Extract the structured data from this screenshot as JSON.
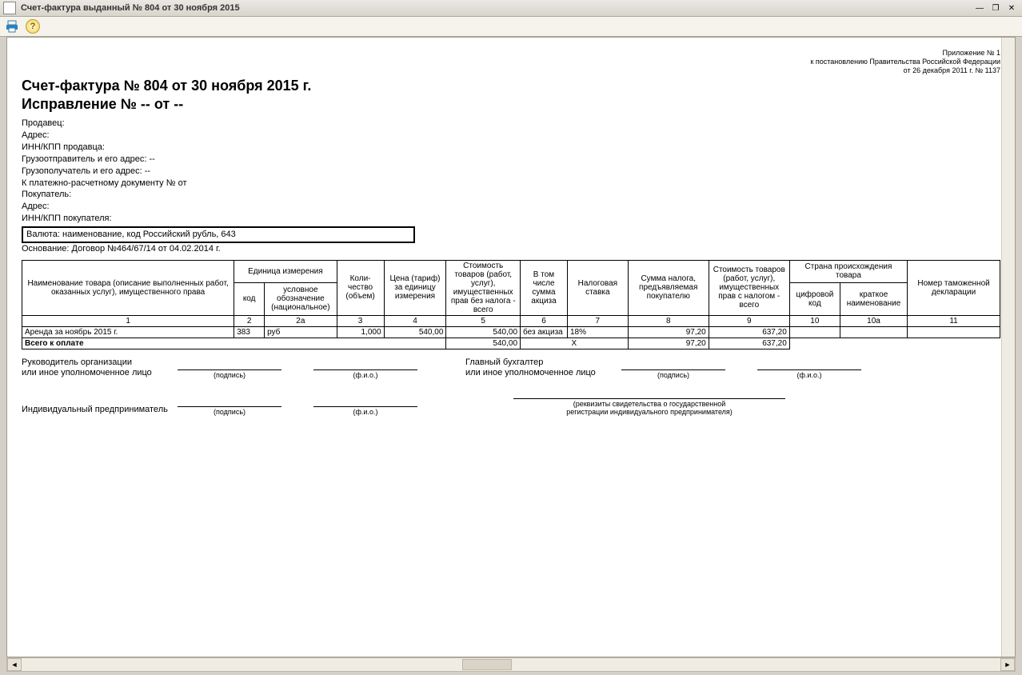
{
  "window": {
    "title": "Счет-фактура выданный № 804 от 30 ноября 2015"
  },
  "appendix": {
    "line1": "Приложение № 1",
    "line2": "к постановлению Правительства Российской Федерации",
    "line3": "от 26 декабря 2011 г. № 1137"
  },
  "doc": {
    "title": "Счет-фактура № 804 от 30 ноября 2015 г.",
    "correction": "Исправление № -- от --"
  },
  "header": {
    "seller": "Продавец:",
    "address": "Адрес:",
    "inn_seller": "ИНН/КПП продавца:",
    "consignor": "Грузоотправитель и его адрес: --",
    "consignee": "Грузополучатель и его адрес: --",
    "payment": "К платежно-расчетному документу №    от",
    "buyer": "Покупатель:",
    "buyer_address": "Адрес:",
    "inn_buyer": "ИНН/КПП покупателя:",
    "currency": "Валюта: наименование, код Российский рубль, 643",
    "basis": "Основание: Договор №464/67/14 от 04.02.2014 г."
  },
  "columns": {
    "name": "Наименование товара (описание выполненных работ, оказанных услуг), имущественного права",
    "unit": "Единица измерения",
    "unit_code": "код",
    "unit_sym": "условное обозначение (национальное)",
    "qty": "Коли-\nчество (объем)",
    "price": "Цена (тариф) за единицу измерения",
    "cost_no_tax": "Стоимость товаров (работ, услуг), имущественных прав без налога - всего",
    "excise": "В том числе сумма акциза",
    "tax_rate": "Налоговая ставка",
    "tax_sum": "Сумма налога, предъявляемая покупателю",
    "cost_with_tax": "Стоимость товаров (работ, услуг), имущественных прав с налогом - всего",
    "country": "Страна происхождения товара",
    "country_code": "цифровой код",
    "country_name": "краткое наименование",
    "customs": "Номер таможенной декларации"
  },
  "col_numbers": {
    "c1": "1",
    "c2": "2",
    "c2a": "2а",
    "c3": "3",
    "c4": "4",
    "c5": "5",
    "c6": "6",
    "c7": "7",
    "c8": "8",
    "c9": "9",
    "c10": "10",
    "c10a": "10а",
    "c11": "11"
  },
  "rows": [
    {
      "name": "Аренда за ноябрь 2015 г.",
      "unit_code": "383",
      "unit_sym": "руб",
      "qty": "1,000",
      "price": "540,00",
      "cost_no_tax": "540,00",
      "excise": "без акциза",
      "tax_rate": "18%",
      "tax_sum": "97,20",
      "cost_with_tax": "637,20",
      "country_code": "",
      "country_name": "",
      "customs": ""
    }
  ],
  "totals": {
    "label": "Всего к оплате",
    "cost_no_tax": "540,00",
    "excise_x": "Х",
    "tax_sum": "97,20",
    "cost_with_tax": "637,20"
  },
  "signatures": {
    "head": "Руководитель организации\nили иное уполномоченное лицо",
    "accountant": "Главный бухгалтер\nили иное уполномоченное лицо",
    "entrepreneur": "Индивидуальный предприниматель",
    "sig": "(подпись)",
    "fio": "(ф.и.о.)",
    "legal": "(реквизиты свидетельства о государственной\nрегистрации индивидуального предпринимателя)"
  }
}
